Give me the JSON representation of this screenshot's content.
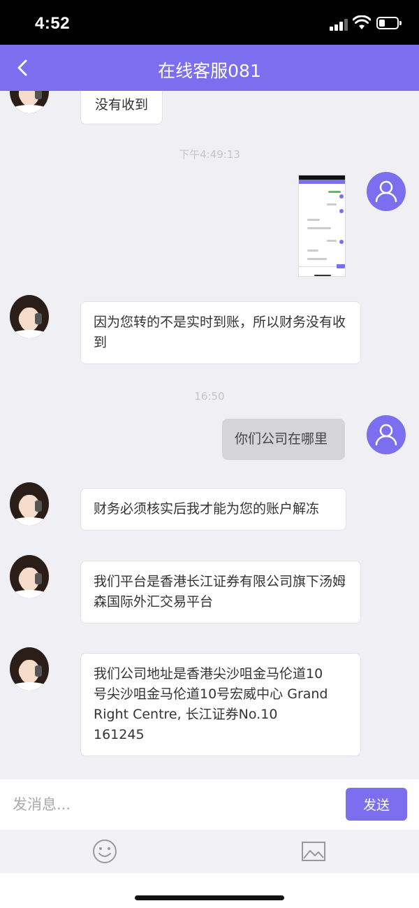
{
  "status_bar": {
    "time": "4:52"
  },
  "header": {
    "title": "在线客服081"
  },
  "messages": [
    {
      "text": "没有收到"
    },
    {
      "timestamp": "下午4:49:13"
    },
    {
      "text": "因为您转的不是实时到账，所以财务没有收到"
    },
    {
      "timestamp": "16:50"
    },
    {
      "text": "你们公司在哪里"
    },
    {
      "text": "财务必须核实后我才能为您的账户解冻"
    },
    {
      "text": "我们平台是香港长江证券有限公司旗下汤姆森国际外汇交易平台"
    },
    {
      "line1": "我们公司地址是香港尖沙咀金马伦道10",
      "line2": "号尖沙咀金马伦道10号宏威中心 Grand",
      "line3": "Right Centre, 长江证券No.10",
      "line4": "161245"
    }
  ],
  "input": {
    "placeholder": "发消息...",
    "send_label": "发送"
  },
  "colors": {
    "accent": "#7b6ff0",
    "background": "#efeff4"
  },
  "icons": [
    "back-icon",
    "user-avatar-icon",
    "emoji-icon",
    "image-icon"
  ]
}
